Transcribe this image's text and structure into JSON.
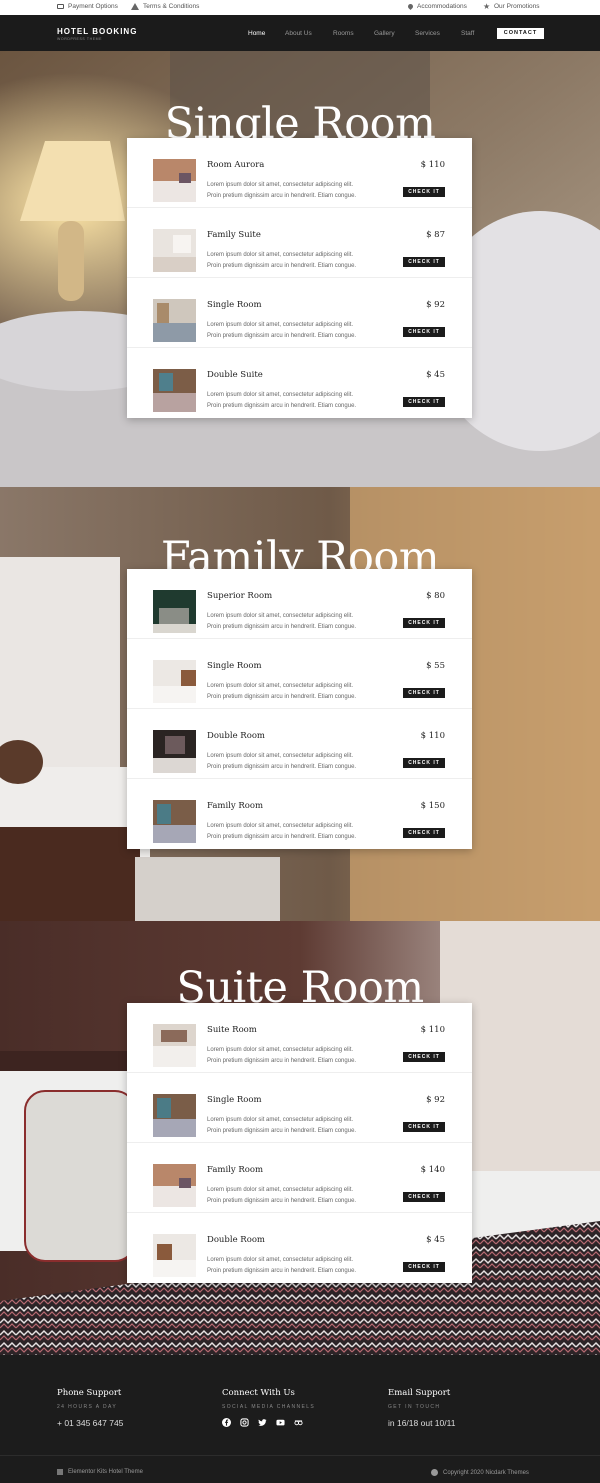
{
  "topbar": {
    "payment_options": "Payment Options",
    "terms": "Terms & Conditions",
    "accommodations": "Accommodations",
    "promotions": "Our Promotions"
  },
  "nav": {
    "logo": "HOTEL BOOKING",
    "logo_sub": "WORDPRESS THEME",
    "items": [
      "Home",
      "About Us",
      "Rooms",
      "Gallery",
      "Services",
      "Staff"
    ],
    "contact": "CONTACT"
  },
  "common": {
    "desc_line1": "Lorem ipsum dolor sit amet, consectetur adipiscing elit.",
    "desc_line2": "Proin pretium dignissim arcu in hendrerit. Etiam congue.",
    "check": "CHECK IT"
  },
  "sections": [
    {
      "title": "Single Room",
      "rooms": [
        {
          "name": "Room Aurora",
          "price": "$ 110"
        },
        {
          "name": "Family Suite",
          "price": "$ 87"
        },
        {
          "name": "Single Room",
          "price": "$ 92"
        },
        {
          "name": "Double Suite",
          "price": "$ 45"
        }
      ]
    },
    {
      "title": "Family Room",
      "rooms": [
        {
          "name": "Superior Room",
          "price": "$ 80"
        },
        {
          "name": "Single Room",
          "price": "$ 55"
        },
        {
          "name": "Double Room",
          "price": "$ 110"
        },
        {
          "name": "Family Room",
          "price": "$ 150"
        }
      ]
    },
    {
      "title": "Suite Room",
      "rooms": [
        {
          "name": "Suite Room",
          "price": "$ 110"
        },
        {
          "name": "Single Room",
          "price": "$ 92"
        },
        {
          "name": "Family Room",
          "price": "$ 140"
        },
        {
          "name": "Double Room",
          "price": "$ 45"
        }
      ]
    }
  ],
  "footer": {
    "phone": {
      "head": "Phone Support",
      "sub": "24 HOURS A DAY",
      "value": "+ 01 345 647 745"
    },
    "connect": {
      "head": "Connect With Us",
      "sub": "SOCIAL MEDIA CHANNELS"
    },
    "email": {
      "head": "Email Support",
      "sub": "GET IN TOUCH",
      "value": "in 16/18 out 10/11"
    },
    "left_note": "Elementor Kits Hotel Theme",
    "copyright": "Copyright 2020 Nicdark Themes",
    "social_icons": [
      "facebook-icon",
      "instagram-icon",
      "twitter-icon",
      "youtube-icon",
      "tripadvisor-icon"
    ]
  },
  "colors": {
    "dark": "#1b1b1b",
    "white": "#ffffff",
    "text": "#222222",
    "muted": "#666666"
  }
}
